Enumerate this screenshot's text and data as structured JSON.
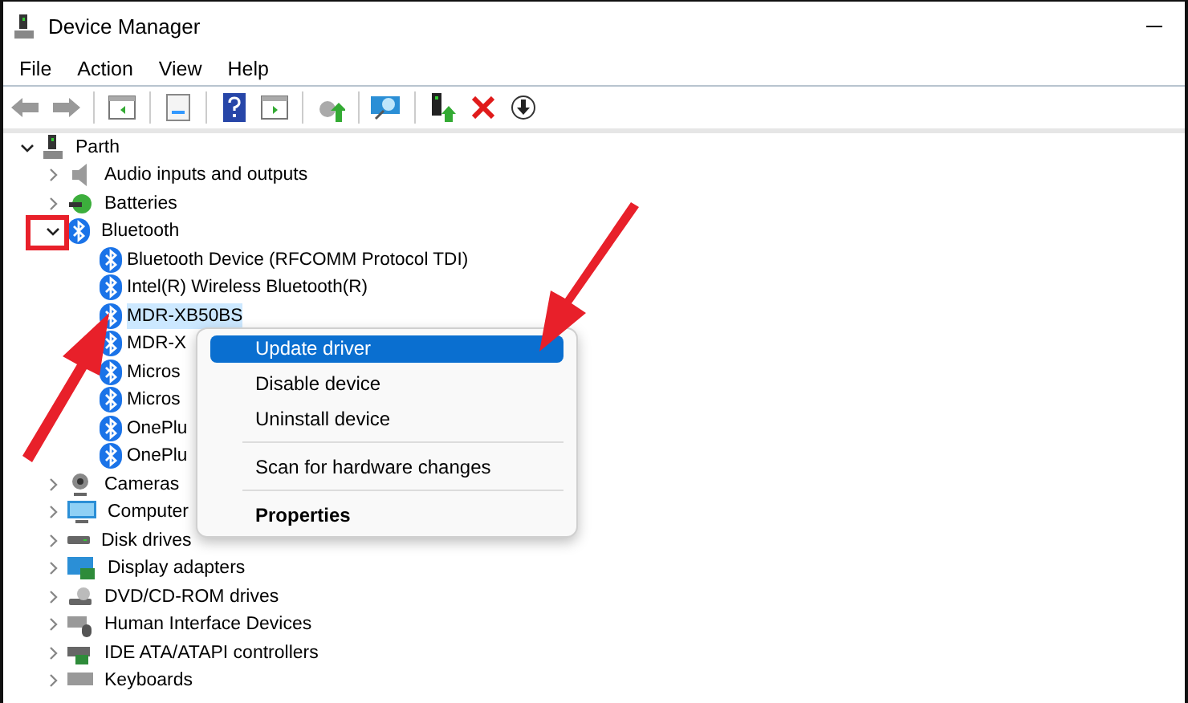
{
  "window": {
    "title": "Device Manager"
  },
  "menu_bar": [
    "File",
    "Action",
    "View",
    "Help"
  ],
  "tree": {
    "label": "Parth",
    "expanded": true,
    "children": [
      {
        "label": "Audio inputs and outputs",
        "expanded": false
      },
      {
        "label": "Batteries",
        "expanded": false
      },
      {
        "label": "Bluetooth",
        "expanded": true,
        "children": [
          {
            "label": "Bluetooth Device (RFCOMM Protocol TDI)",
            "selected": false
          },
          {
            "label": "Intel(R) Wireless Bluetooth(R)",
            "selected": false
          },
          {
            "label": "MDR-XB50BS",
            "selected": true
          },
          {
            "label": "MDR-X",
            "selected": false
          },
          {
            "label": "Micros",
            "selected": false
          },
          {
            "label": "Micros",
            "selected": false
          },
          {
            "label": "OnePlu",
            "selected": false
          },
          {
            "label": "OnePlu",
            "selected": false
          }
        ]
      },
      {
        "label": "Cameras",
        "expanded": false
      },
      {
        "label": "Computer",
        "expanded": false
      },
      {
        "label": "Disk drives",
        "expanded": false
      },
      {
        "label": "Display adapters",
        "expanded": false
      },
      {
        "label": "DVD/CD-ROM drives",
        "expanded": false
      },
      {
        "label": "Human Interface Devices",
        "expanded": false
      },
      {
        "label": "IDE ATA/ATAPI controllers",
        "expanded": false
      },
      {
        "label": "Keyboards",
        "expanded": false
      }
    ]
  },
  "context_menu": [
    {
      "kind": "item",
      "label": "Update driver",
      "selected": true
    },
    {
      "kind": "item",
      "label": "Disable device",
      "selected": false
    },
    {
      "kind": "item",
      "label": "Uninstall device",
      "selected": false
    },
    {
      "kind": "separator"
    },
    {
      "kind": "item",
      "label": "Scan for hardware changes",
      "selected": false
    },
    {
      "kind": "separator"
    },
    {
      "kind": "default",
      "label": "Properties",
      "selected": false
    }
  ]
}
